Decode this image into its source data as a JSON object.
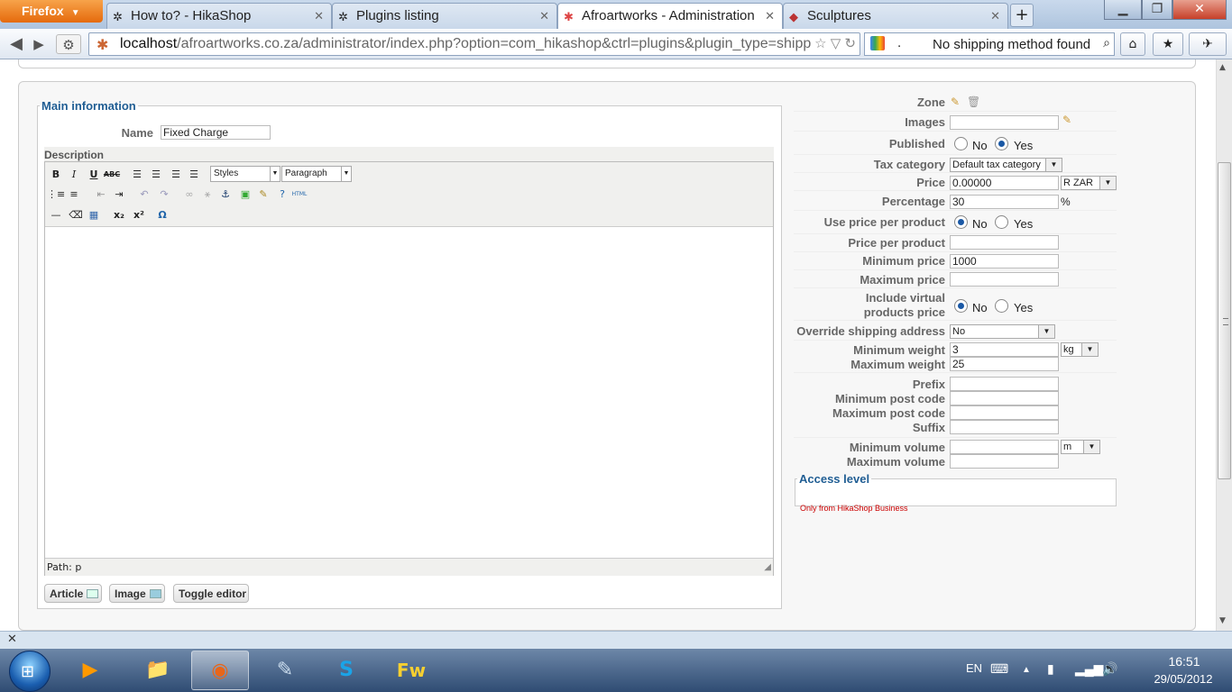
{
  "browser": {
    "menu_label": "Firefox",
    "tabs": [
      {
        "label": "How to? - HikaShop"
      },
      {
        "label": "Plugins listing"
      },
      {
        "label": "Afroartworks - Administration"
      },
      {
        "label": "Sculptures"
      }
    ],
    "new_tab": "+",
    "url_host": "localhost",
    "url_rest": "/afroartworks.co.za/administrator/index.php?option=com_hikashop&ctrl=plugins&plugin_type=shipping&",
    "search_text": "No shipping method found",
    "search_prefix": "."
  },
  "main_info": {
    "legend": "Main information",
    "name_label": "Name",
    "name_value": "Fixed Charge",
    "description_label": "Description",
    "styles_select": "Styles",
    "paragraph_select": "Paragraph",
    "path_text": "Path: p",
    "buttons": {
      "article": "Article",
      "image": "Image",
      "toggle_editor": "Toggle editor"
    }
  },
  "params": {
    "zone": "Zone",
    "images": "Images",
    "published": "Published",
    "tax_category": "Tax category",
    "tax_category_value": "Default tax category",
    "price": "Price",
    "price_value": "0.00000",
    "currency_value": "R ZAR",
    "percentage": "Percentage",
    "percentage_value": "30",
    "percent_sign": "%",
    "use_price_per_product": "Use price per product",
    "price_per_product": "Price per product",
    "minimum_price": "Minimum price",
    "minimum_price_value": "1000",
    "maximum_price": "Maximum price",
    "include_virtual_1": "Include virtual",
    "include_virtual_2": "products price",
    "override_shipping": "Override shipping address",
    "override_value": "No",
    "minimum_weight": "Minimum weight",
    "minimum_weight_value": "3",
    "weight_unit": "kg",
    "maximum_weight": "Maximum weight",
    "maximum_weight_value": "25",
    "prefix": "Prefix",
    "minimum_post_code": "Minimum post code",
    "maximum_post_code": "Maximum post code",
    "suffix": "Suffix",
    "minimum_volume": "Minimum volume",
    "volume_unit": "m",
    "maximum_volume": "Maximum volume",
    "radio_no": "No",
    "radio_yes": "Yes"
  },
  "access": {
    "legend": "Access level",
    "note": "Only from HikaShop Business"
  },
  "taskbar": {
    "lang": "EN",
    "time": "16:51",
    "date": "29/05/2012"
  }
}
